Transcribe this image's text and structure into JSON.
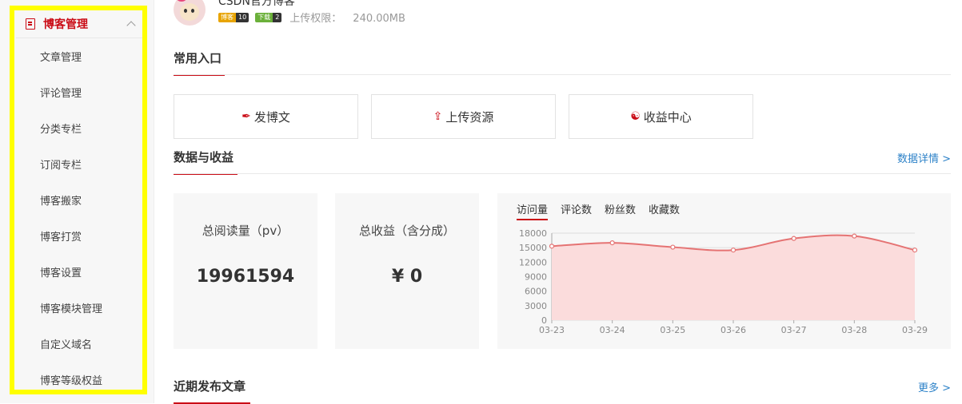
{
  "sidebar": {
    "header": "博客管理",
    "items": [
      "文章管理",
      "评论管理",
      "分类专栏",
      "订阅专栏",
      "博客搬家",
      "博客打赏",
      "博客设置",
      "博客模块管理",
      "自定义域名",
      "博客等级权益"
    ]
  },
  "user": {
    "name": "CSDN官方博客",
    "badges": [
      {
        "label": "博客",
        "level": "10"
      },
      {
        "label": "下载",
        "level": "2"
      }
    ],
    "quota_label": "上传权限：",
    "quota_value": "240.00MB"
  },
  "sections": {
    "common": "常用入口",
    "data": "数据与收益",
    "data_more": "数据详情 >",
    "recent": "近期发布文章",
    "recent_more": "更多 >"
  },
  "entries": [
    {
      "label": "发博文",
      "icon": "pen-icon"
    },
    {
      "label": "上传资源",
      "icon": "upload-icon"
    },
    {
      "label": "收益中心",
      "icon": "income-icon"
    }
  ],
  "stats": {
    "pv_label": "总阅读量（pv）",
    "pv_value": "19961594",
    "income_label": "总收益（含分成）",
    "income_value": "¥ 0"
  },
  "chart_tabs": [
    "访问量",
    "评论数",
    "粉丝数",
    "收藏数"
  ],
  "colors": {
    "accent": "#ca0c16",
    "link": "#2d82c8",
    "line": "#e57373",
    "area": "#fbdcdc"
  },
  "chart_data": {
    "type": "area",
    "x": [
      "03-23",
      "03-24",
      "03-25",
      "03-26",
      "03-27",
      "03-28",
      "03-29"
    ],
    "series": [
      {
        "values": [
          15300,
          16000,
          15100,
          14500,
          16900,
          17400,
          14500
        ]
      }
    ],
    "ylim": [
      0,
      18000
    ],
    "yticks": [
      0,
      3000,
      6000,
      9000,
      12000,
      15000,
      18000
    ],
    "grid": true
  }
}
